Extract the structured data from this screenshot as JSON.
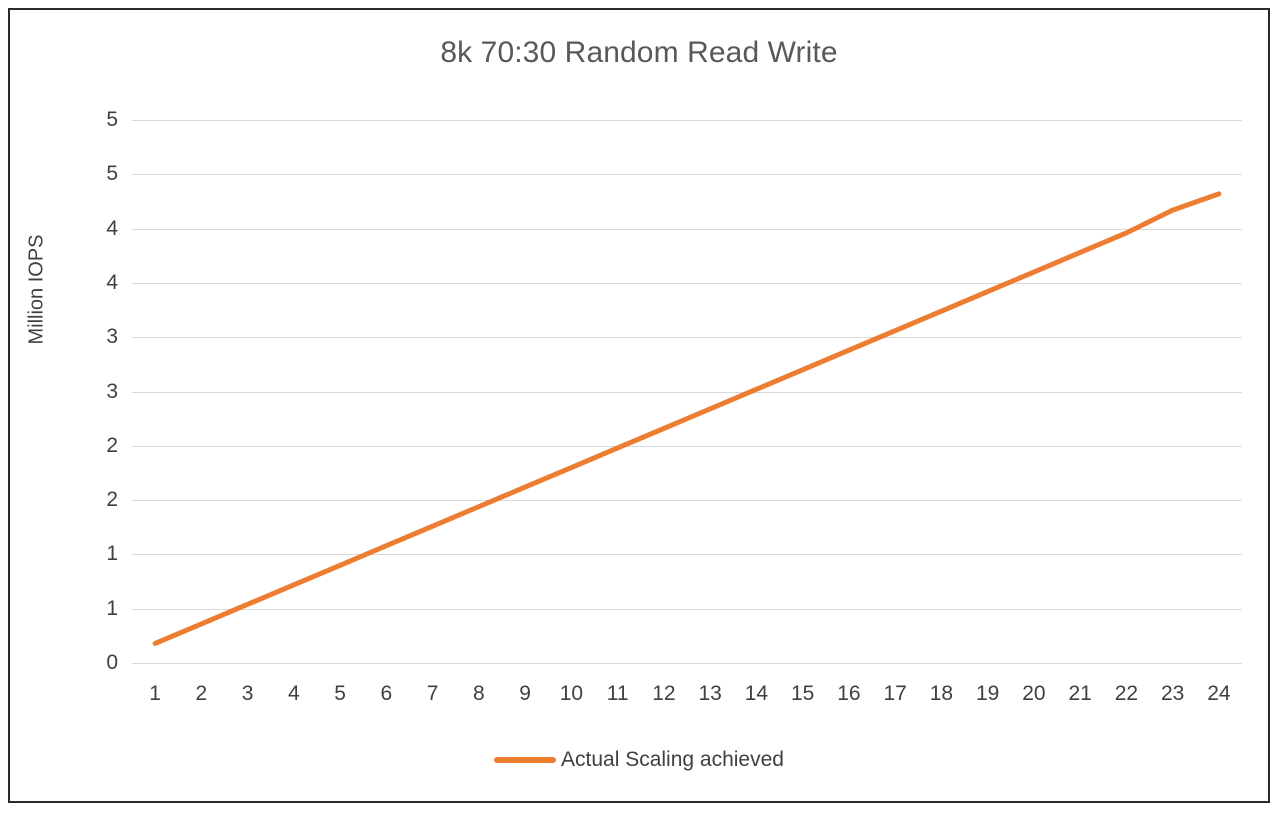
{
  "chart_data": {
    "type": "line",
    "title": "8k 70:30 Random Read Write",
    "xlabel": "",
    "ylabel": "Million IOPS",
    "grid": true,
    "legend_position": "bottom",
    "x": [
      1,
      2,
      3,
      4,
      5,
      6,
      7,
      8,
      9,
      10,
      11,
      12,
      13,
      14,
      15,
      16,
      17,
      18,
      19,
      20,
      21,
      22,
      23,
      24
    ],
    "categories": [
      "1",
      "2",
      "3",
      "4",
      "5",
      "6",
      "7",
      "8",
      "9",
      "10",
      "11",
      "12",
      "13",
      "14",
      "15",
      "16",
      "17",
      "18",
      "19",
      "20",
      "21",
      "22",
      "23",
      "24"
    ],
    "xtick_labels": [
      "1",
      "2",
      "3",
      "4",
      "5",
      "6",
      "7",
      "8",
      "9",
      "10",
      "11",
      "12",
      "13",
      "14",
      "15",
      "16",
      "17",
      "18",
      "19",
      "20",
      "21",
      "22",
      "23",
      "24"
    ],
    "ylim": [
      0,
      5
    ],
    "ytick_values": [
      0,
      0.5,
      1.0,
      1.5,
      2.0,
      2.5,
      3.0,
      3.5,
      4.0,
      4.5,
      5.0
    ],
    "ytick_labels": [
      "0",
      "1",
      "1",
      "2",
      "2",
      "3",
      "3",
      "4",
      "4",
      "5",
      "5"
    ],
    "series": [
      {
        "name": "Actual Scaling achieved",
        "color": "#ED7D31",
        "line_width": 5,
        "values": [
          0.18,
          0.36,
          0.54,
          0.72,
          0.9,
          1.08,
          1.26,
          1.44,
          1.62,
          1.8,
          1.98,
          2.16,
          2.34,
          2.52,
          2.7,
          2.88,
          3.06,
          3.24,
          3.42,
          3.6,
          3.78,
          3.96,
          4.17,
          4.32
        ]
      }
    ]
  },
  "legend": {
    "entries": [
      {
        "label": "Actual Scaling achieved",
        "color": "#ED7D31"
      }
    ]
  },
  "colors": {
    "series_orange": "#ED7D31",
    "gridline": "#D9D9D9",
    "text": "#404040",
    "title_text": "#595959",
    "border": "#2B2B2B",
    "background": "#FFFFFF"
  }
}
